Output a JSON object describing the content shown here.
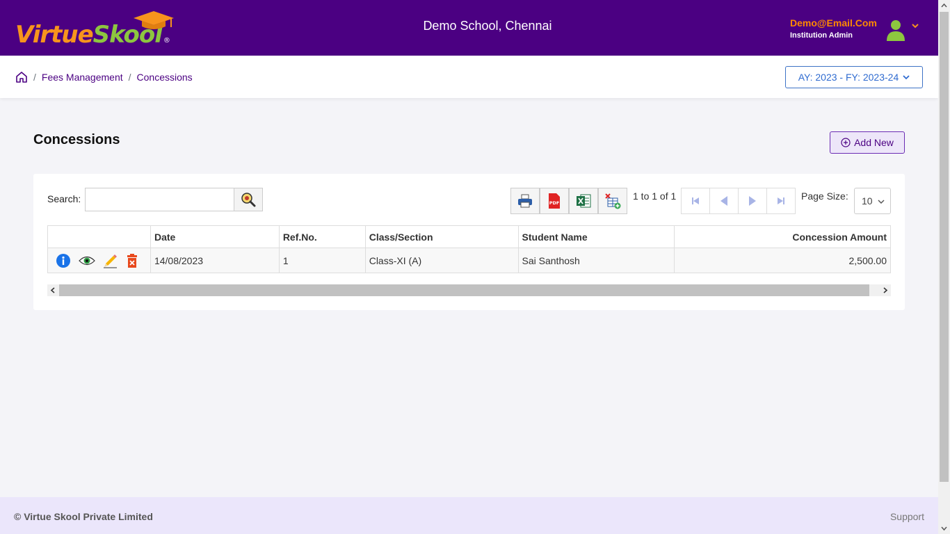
{
  "header": {
    "logo": {
      "part1": "Virtue",
      "part2": "Skool",
      "registered": "®"
    },
    "school_name": "Demo School, Chennai",
    "user_email": "Demo@Email.Com",
    "user_role": "Institution Admin"
  },
  "breadcrumb": {
    "items": [
      "Fees Management",
      "Concessions"
    ],
    "separator": "/"
  },
  "academic_year_select": "AY: 2023 - FY: 2023-24",
  "page": {
    "title": "Concessions",
    "add_new_label": "Add New"
  },
  "toolbar": {
    "search_label": "Search:",
    "search_value": "",
    "pager_info": "1 to 1 of 1",
    "page_size_label": "Page Size:",
    "page_size_value": "10"
  },
  "table": {
    "columns": [
      "",
      "Date",
      "Ref.No.",
      "Class/Section",
      "Student Name",
      "Concession Amount"
    ],
    "rows": [
      {
        "date": "14/08/2023",
        "ref_no": "1",
        "class_section": "Class-XI (A)",
        "student_name": "Sai Santhosh",
        "amount": "2,500.00"
      }
    ]
  },
  "footer": {
    "copyright": "© Virtue Skool Private Limited",
    "support": "Support"
  },
  "colors": {
    "header_bg": "#4b0082",
    "accent_orange": "#f7941d",
    "accent_green": "#8dc63f",
    "footer_bg": "#ebe6fb"
  }
}
